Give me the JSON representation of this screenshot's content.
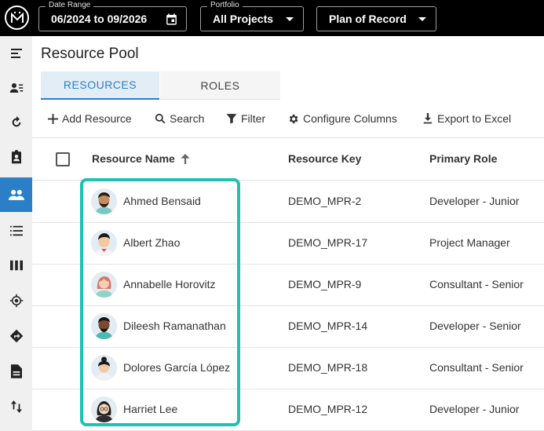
{
  "topbar": {
    "date_range": {
      "label": "Date Range",
      "value": "06/2024 to 09/2026"
    },
    "portfolio": {
      "label": "Portfolio",
      "value": "All Projects"
    },
    "plan": {
      "value": "Plan of Record"
    }
  },
  "sidebar": {
    "items": [
      {
        "icon": "collapse-menu-icon"
      },
      {
        "icon": "person-list-icon"
      },
      {
        "icon": "refresh-icon"
      },
      {
        "icon": "clipboard-user-icon"
      },
      {
        "icon": "people-icon",
        "active": true
      },
      {
        "icon": "list-icon"
      },
      {
        "icon": "columns-icon"
      },
      {
        "icon": "target-icon"
      },
      {
        "icon": "directions-icon"
      },
      {
        "icon": "document-icon"
      },
      {
        "icon": "sort-arrows-icon"
      }
    ]
  },
  "page": {
    "title": "Resource Pool"
  },
  "tabs": [
    {
      "label": "RESOURCES",
      "active": true
    },
    {
      "label": "ROLES",
      "active": false
    }
  ],
  "toolbar": {
    "add": "Add Resource",
    "search": "Search",
    "filter": "Filter",
    "configure": "Configure Columns",
    "export": "Export to Excel"
  },
  "table": {
    "columns": [
      "Resource Name",
      "Resource Key",
      "Primary Role"
    ],
    "sort": {
      "column": "Resource Name",
      "direction": "ascending"
    },
    "rows": [
      {
        "name": "Ahmed Bensaid",
        "key": "DEMO_MPR-2",
        "role": "Developer - Junior"
      },
      {
        "name": "Albert Zhao",
        "key": "DEMO_MPR-17",
        "role": "Project Manager"
      },
      {
        "name": "Annabelle Horovitz",
        "key": "DEMO_MPR-9",
        "role": "Consultant - Senior"
      },
      {
        "name": "Dileesh Ramanathan",
        "key": "DEMO_MPR-14",
        "role": "Developer - Senior"
      },
      {
        "name": "Dolores García López",
        "key": "DEMO_MPR-18",
        "role": "Consultant - Senior"
      },
      {
        "name": "Harriet Lee",
        "key": "DEMO_MPR-12",
        "role": "Developer - Junior"
      }
    ]
  },
  "colors": {
    "topbar": "#000000",
    "accent": "#2a7fc6",
    "highlight": "#1fc1b3",
    "sidebar": "#f0f0f0"
  }
}
